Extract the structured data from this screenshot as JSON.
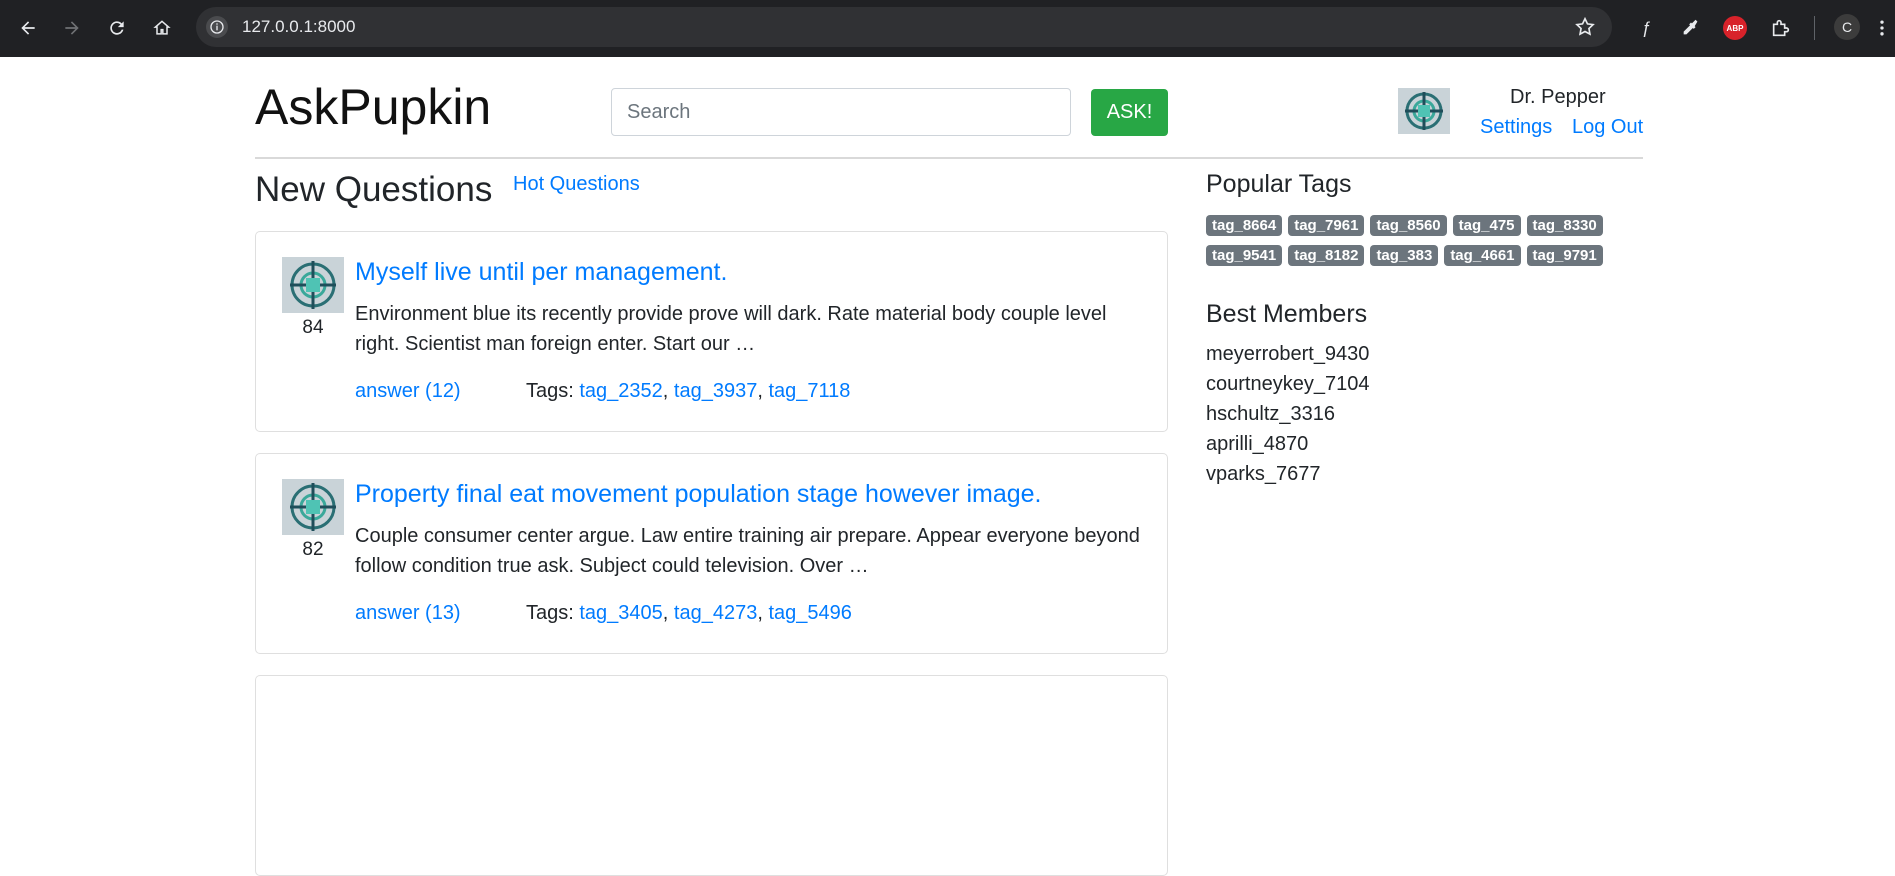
{
  "browser": {
    "url": "127.0.0.1:8000",
    "profile_initial": "C",
    "ext_label": "ABP"
  },
  "header": {
    "logo": "AskPupkin",
    "search_placeholder": "Search",
    "ask_label": "ASK!",
    "user_name": "Dr. Pepper",
    "settings_label": "Settings",
    "logout_label": "Log Out"
  },
  "main": {
    "heading": "New Questions",
    "hot_link": "Hot Questions",
    "tags_label": "Tags:",
    "questions": [
      {
        "score": "84",
        "title": "Myself live until per management.",
        "body": "Environment blue its recently provide prove will dark. Rate material body couple level right. Scientist man foreign enter. Start our …",
        "answer": "answer (12)",
        "tags": [
          "tag_2352",
          "tag_3937",
          "tag_7118"
        ]
      },
      {
        "score": "82",
        "title": "Property final eat movement population stage however image.",
        "body": "Couple consumer center argue. Law entire training air prepare. Appear everyone beyond follow condition true ask. Subject could television. Over …",
        "answer": "answer (13)",
        "tags": [
          "tag_3405",
          "tag_4273",
          "tag_5496"
        ]
      }
    ]
  },
  "sidebar": {
    "popular_tags_heading": "Popular Tags",
    "popular_tags_row1": [
      "tag_8664",
      "tag_7961",
      "tag_8560",
      "tag_475",
      "tag_8330"
    ],
    "popular_tags_row2": [
      "tag_9541",
      "tag_8182",
      "tag_383",
      "tag_4661",
      "tag_9791"
    ],
    "best_members_heading": "Best Members",
    "best_members": [
      "meyerrobert_9430",
      "courtneykey_7104",
      "hschultz_3316",
      "aprilli_4870",
      "vparks_7677"
    ]
  },
  "colors": {
    "link": "#007bff",
    "ask_button": "#28a745",
    "badge": "#6c757d",
    "chrome": "#202124"
  }
}
